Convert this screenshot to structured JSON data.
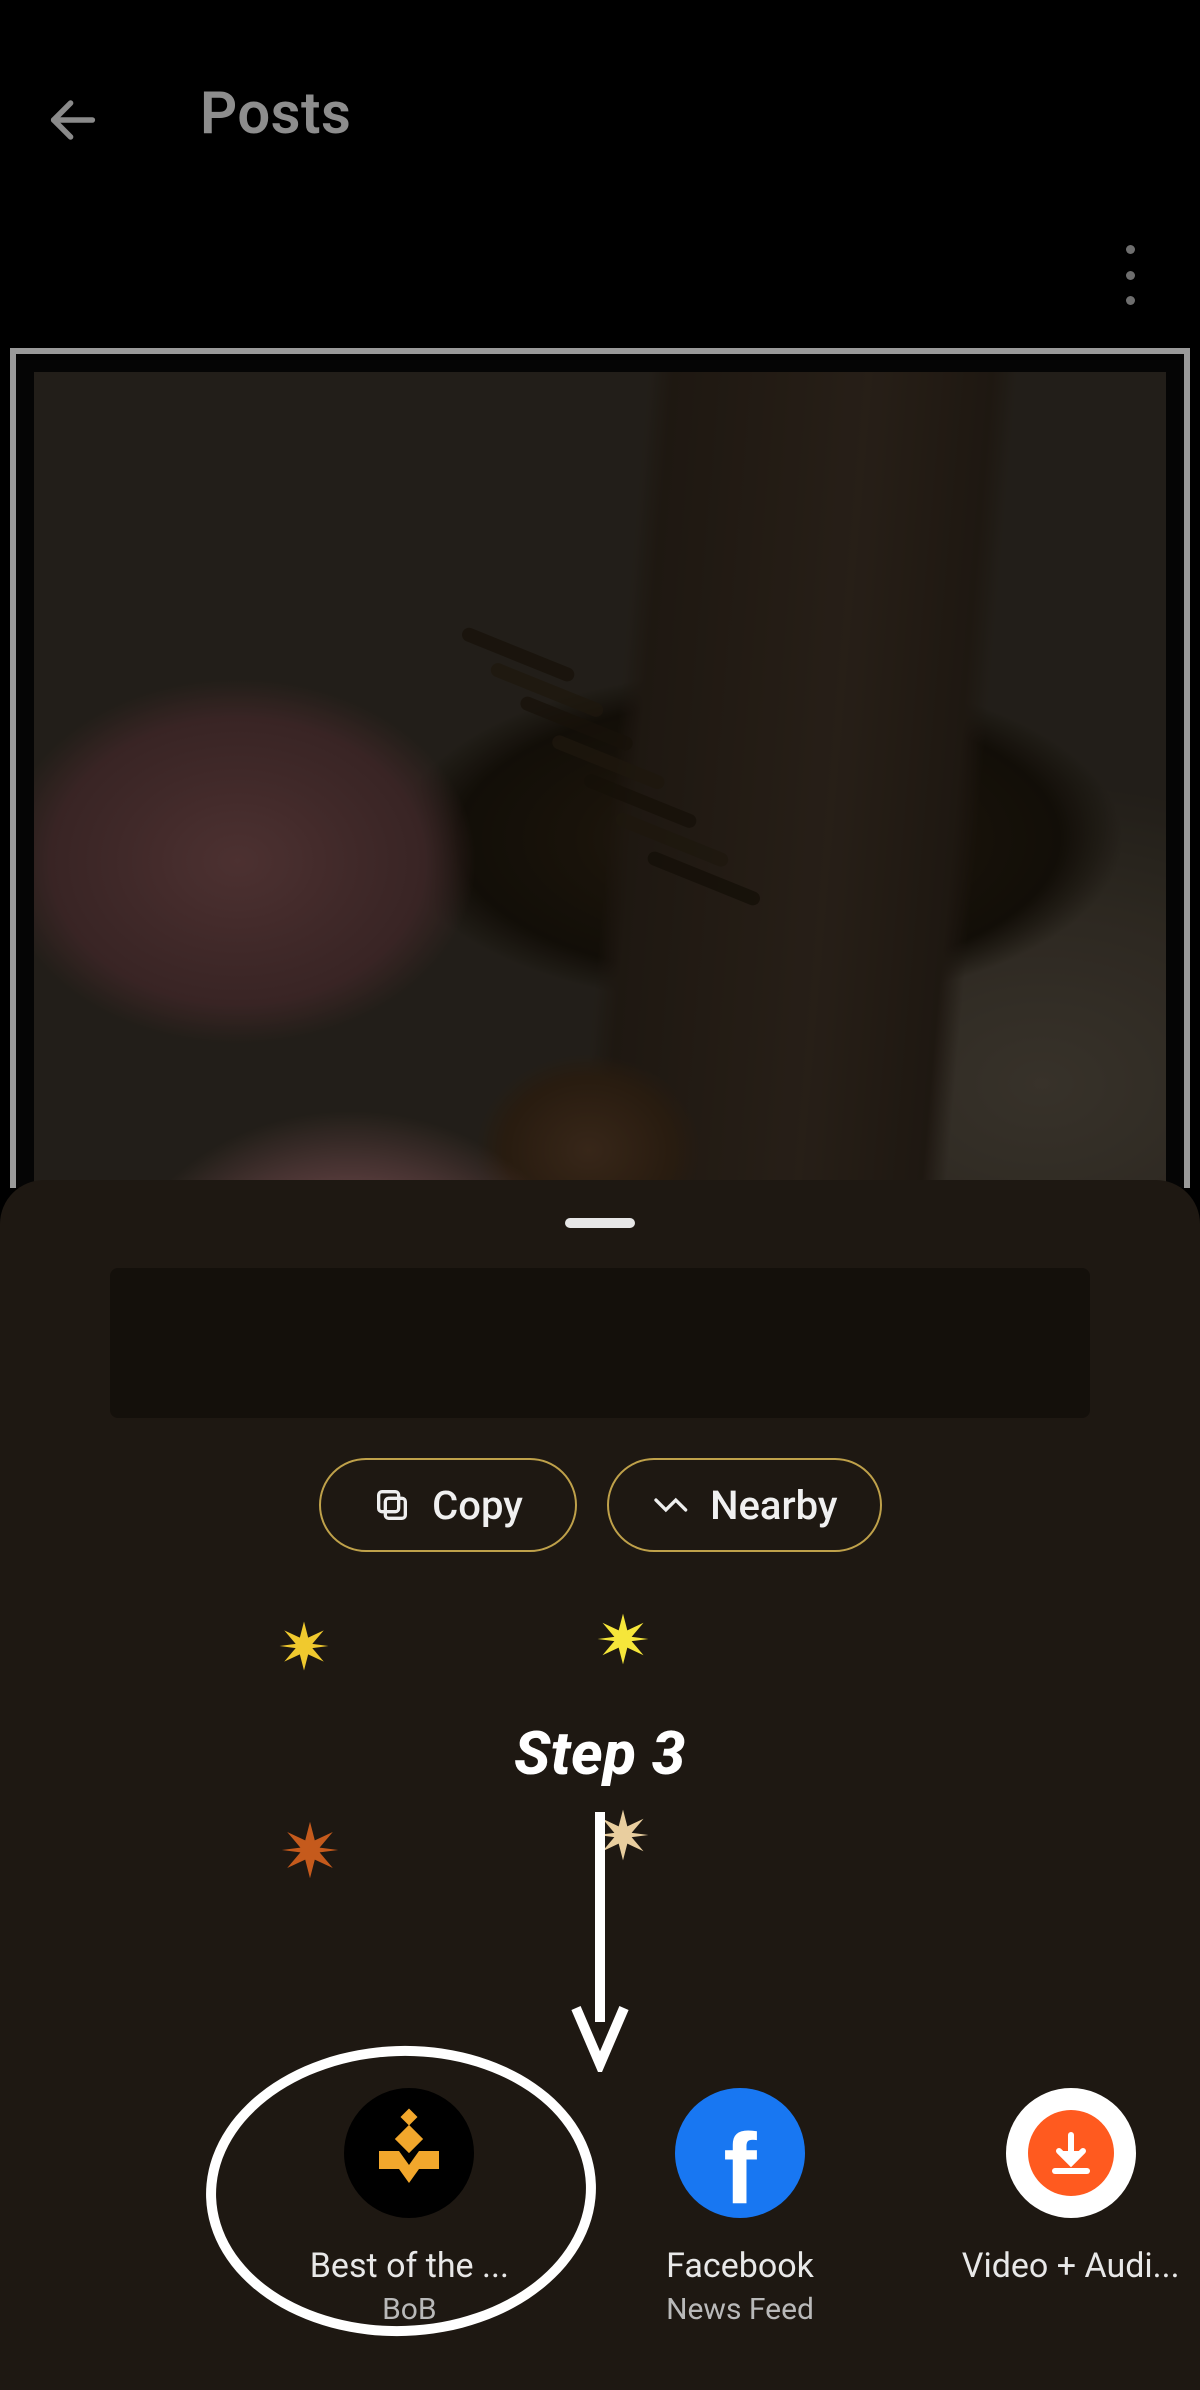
{
  "header": {
    "title": "Posts"
  },
  "share_sheet": {
    "actions": {
      "copy_label": "Copy",
      "nearby_label": "Nearby"
    },
    "targets": [
      {
        "title": "Best of the ...",
        "subtitle": "BoB"
      },
      {
        "title": "Facebook",
        "subtitle": "News Feed"
      },
      {
        "title": "Video + Audi...",
        "subtitle": ""
      }
    ]
  },
  "annotation": {
    "step_label": "Step 3"
  }
}
